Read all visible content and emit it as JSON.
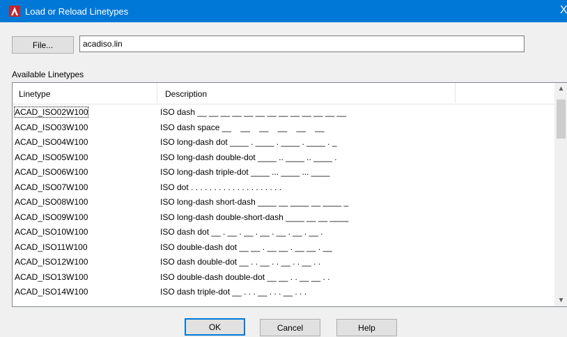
{
  "window": {
    "title": "Load or Reload Linetypes",
    "close_glyph": "X",
    "titlebar_color": "#0078d7",
    "icon": "autocad-icon"
  },
  "file": {
    "button_label": "File...",
    "path_value": "acadiso.lin"
  },
  "list": {
    "label": "Available Linetypes",
    "columns": [
      "Linetype",
      "Description"
    ],
    "rows": [
      {
        "name": "ACAD_ISO02W100",
        "desc": "ISO dash __ __ __ __ __ __ __ __ __ __ __ __ __"
      },
      {
        "name": "ACAD_ISO03W100",
        "desc": "ISO dash space __    __    __    __    __    __"
      },
      {
        "name": "ACAD_ISO04W100",
        "desc": "ISO long-dash dot ____ . ____ . ____ . ____ . _"
      },
      {
        "name": "ACAD_ISO05W100",
        "desc": "ISO long-dash double-dot ____ .. ____ .. ____ ."
      },
      {
        "name": "ACAD_ISO06W100",
        "desc": "ISO long-dash triple-dot ____ ... ____ ... ____"
      },
      {
        "name": "ACAD_ISO07W100",
        "desc": "ISO dot . . . . . . . . . . . . . . . . . . . ."
      },
      {
        "name": "ACAD_ISO08W100",
        "desc": "ISO long-dash short-dash ____ __ ____ __ ____ _"
      },
      {
        "name": "ACAD_ISO09W100",
        "desc": "ISO long-dash double-short-dash ____ __ __ ____"
      },
      {
        "name": "ACAD_ISO10W100",
        "desc": "ISO dash dot __ . __ . __ . __ . __ . __ . __ ."
      },
      {
        "name": "ACAD_ISO11W100",
        "desc": "ISO double-dash dot __ __ . __ __ . __ __ . __"
      },
      {
        "name": "ACAD_ISO12W100",
        "desc": "ISO dash double-dot __ . . __ . . __ . . __ . ."
      },
      {
        "name": "ACAD_ISO13W100",
        "desc": "ISO double-dash double-dot __ __ . . __ __ . ."
      },
      {
        "name": "ACAD_ISO14W100",
        "desc": "ISO dash triple-dot __ . . . __ . . . __ . . ."
      }
    ]
  },
  "buttons": {
    "ok": "OK",
    "cancel": "Cancel",
    "help": "Help"
  }
}
